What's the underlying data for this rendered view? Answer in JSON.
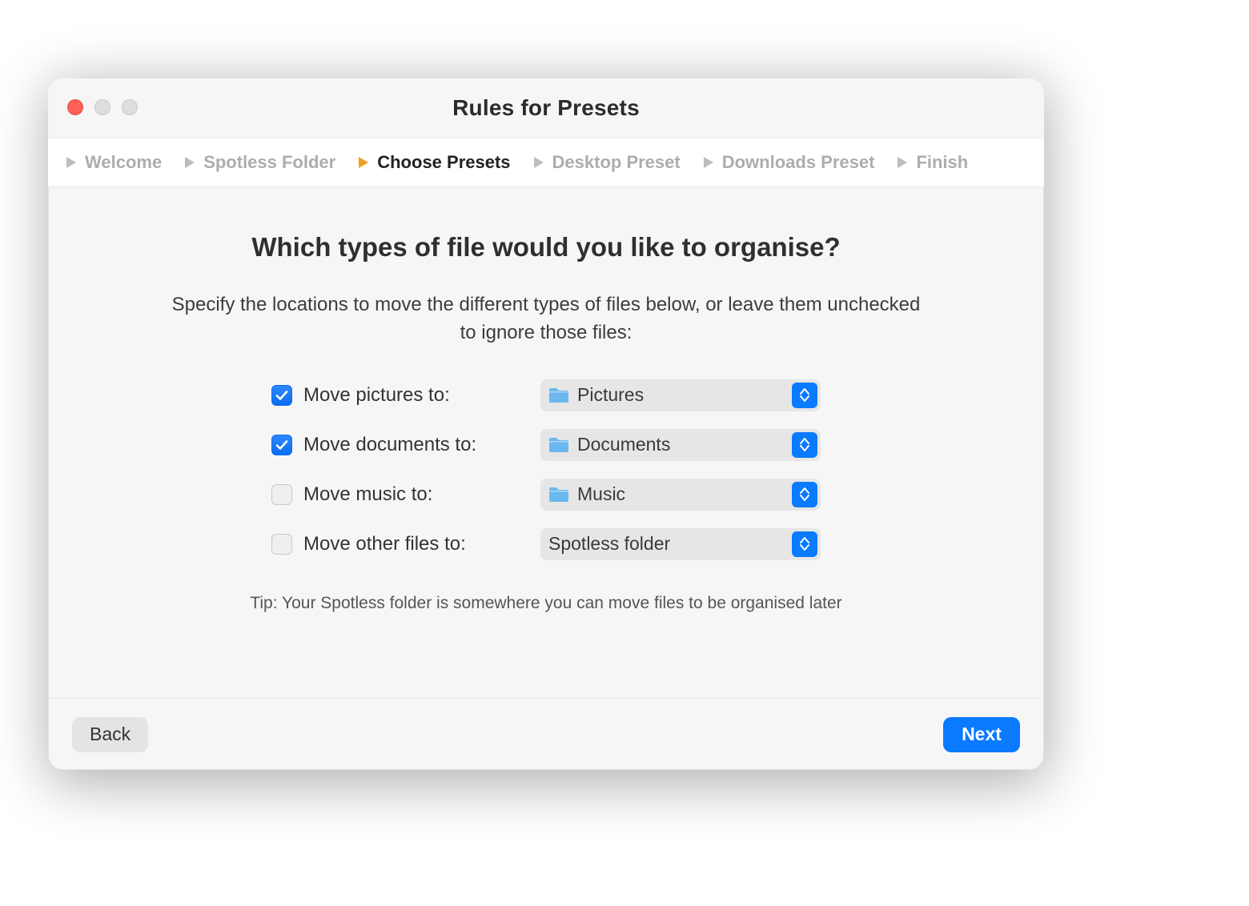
{
  "window": {
    "title": "Rules for Presets"
  },
  "steps": [
    {
      "label": "Welcome",
      "active": false
    },
    {
      "label": "Spotless Folder",
      "active": false
    },
    {
      "label": "Choose Presets",
      "active": true
    },
    {
      "label": "Desktop Preset",
      "active": false
    },
    {
      "label": "Downloads Preset",
      "active": false
    },
    {
      "label": "Finish",
      "active": false
    }
  ],
  "heading": "Which types of file would you like to organise?",
  "subhead": "Specify the locations to move the different types of files below, or leave them unchecked to ignore those files:",
  "rows": [
    {
      "checked": true,
      "label": "Move pictures to:",
      "value": "Pictures",
      "has_icon": true
    },
    {
      "checked": true,
      "label": "Move documents to:",
      "value": "Documents",
      "has_icon": true
    },
    {
      "checked": false,
      "label": "Move music to:",
      "value": "Music",
      "has_icon": true
    },
    {
      "checked": false,
      "label": "Move other files to:",
      "value": "Spotless folder",
      "has_icon": false
    }
  ],
  "tip": "Tip: Your Spotless folder is somewhere you can move files to be organised later",
  "buttons": {
    "back": "Back",
    "next": "Next"
  },
  "colors": {
    "accent": "#0a7aff",
    "step_active_arrow": "#f0a020"
  }
}
